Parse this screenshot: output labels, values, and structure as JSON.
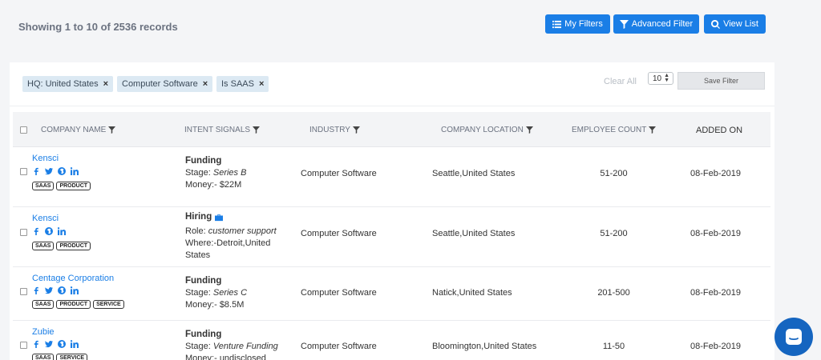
{
  "header": {
    "records_text": "Showing 1 to 10 of 2536 records",
    "buttons": {
      "my_filters": "My Filters",
      "advanced_filter": "Advanced Filter",
      "view_list": "View List"
    }
  },
  "filters": {
    "chips": [
      "HQ: United States",
      "Computer Software",
      "Is SAAS"
    ],
    "remove_glyph": "×",
    "clear_all": "Clear All",
    "page_size": "10",
    "save_filter": "Save Filter"
  },
  "table": {
    "columns": {
      "company": "Company Name",
      "intent": "Intent Signals",
      "industry": "Industry",
      "location": "Company Location",
      "employees": "Employee Count",
      "added": "Added On"
    },
    "rows": [
      {
        "company": "Kensci",
        "socials": [
          "facebook-icon",
          "twitter-icon",
          "globe-icon",
          "linkedin-icon"
        ],
        "tags": [
          "SAAS",
          "PRODUCT"
        ],
        "intent_title": "Funding",
        "line1_label": "Stage:",
        "line1_value": "Series B",
        "line2_label": "Money:-",
        "line2_value": "$22M",
        "industry": "Computer Software",
        "location": "Seattle,United States",
        "employees": "51-200",
        "added": "08-Feb-2019"
      },
      {
        "company": "Kensci",
        "socials": [
          "facebook-icon",
          "globe-icon",
          "linkedin-icon"
        ],
        "tags": [
          "SAAS",
          "PRODUCT"
        ],
        "intent_title": "Hiring",
        "line1_label": "Role:",
        "line1_value": "customer support",
        "line2_label": "Where:-Detroit,United",
        "line2_value": "States",
        "industry": "Computer Software",
        "location": "Seattle,United States",
        "employees": "51-200",
        "added": "08-Feb-2019"
      },
      {
        "company": "Centage Corporation",
        "socials": [
          "facebook-icon",
          "twitter-icon",
          "globe-icon",
          "linkedin-icon"
        ],
        "tags": [
          "SAAS",
          "PRODUCT",
          "SERVICE"
        ],
        "intent_title": "Funding",
        "line1_label": "Stage:",
        "line1_value": "Series C",
        "line2_label": "Money:-",
        "line2_value": "$8.5M",
        "industry": "Computer Software",
        "location": "Natick,United States",
        "employees": "201-500",
        "added": "08-Feb-2019"
      },
      {
        "company": "Zubie",
        "socials": [
          "facebook-icon",
          "twitter-icon",
          "globe-icon",
          "linkedin-icon"
        ],
        "tags": [
          "SAAS",
          "SERVICE"
        ],
        "intent_title": "Funding",
        "line1_label": "Stage:",
        "line1_value": "Venture Funding",
        "line2_label": "Money:-",
        "line2_value": "undisclosed",
        "industry": "Computer Software",
        "location": "Bloomington,United States",
        "employees": "11-50",
        "added": "08-Feb-2019"
      }
    ]
  },
  "colors": {
    "accent": "#1a7ee6",
    "chip_bg": "#dce9f3",
    "chat_bg": "#1565c0"
  }
}
